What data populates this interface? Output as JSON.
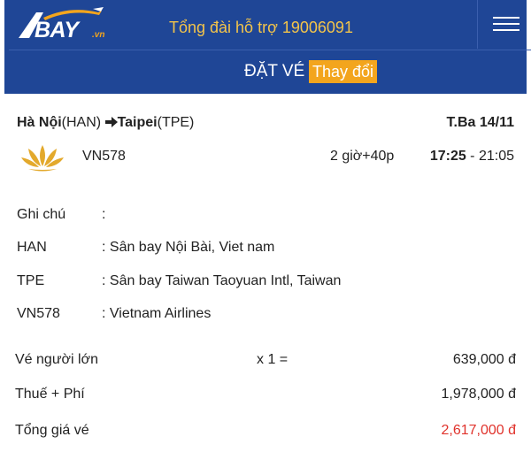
{
  "header": {
    "logo": "BAY",
    "logo_suffix": ".vn",
    "hotline": "Tổng đài hỗ trợ 19006091"
  },
  "subbar": {
    "title": "ĐẶT VÉ",
    "change_label": "Thay đổi"
  },
  "flight": {
    "from_city": "Hà Nội",
    "from_code": "(HAN)",
    "to_city": "Taipei",
    "to_code": "(TPE)",
    "date": "T.Ba 14/11",
    "flight_no": "VN578",
    "duration": "2 giờ+40p",
    "depart": "17:25",
    "arrive": "21:05"
  },
  "details": [
    {
      "key": "Ghi chú",
      "value": ":"
    },
    {
      "key": "HAN",
      "value": ": Sân bay Nội Bài, Viet nam"
    },
    {
      "key": "TPE",
      "value": ": Sân bay Taiwan Taoyuan Intl, Taiwan"
    },
    {
      "key": "VN578",
      "value": ": Vietnam Airlines"
    }
  ],
  "prices": {
    "adult_label": "Vé người lớn",
    "adult_qty": "x 1 =",
    "adult_amount": "639,000 đ",
    "tax_label": "Thuế + Phí",
    "tax_amount": "1,978,000 đ",
    "total_label": "Tổng giá vé",
    "total_amount": "2,617,000 đ"
  },
  "colors": {
    "header_bg": "#1f4696",
    "accent": "#f3a51d",
    "total_price": "#e0322b"
  }
}
